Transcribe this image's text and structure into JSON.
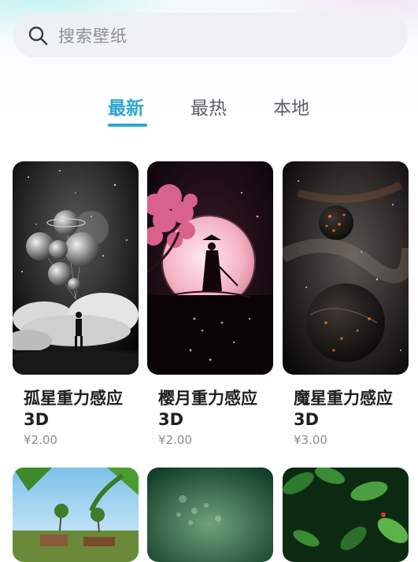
{
  "search": {
    "placeholder": "搜索壁纸",
    "icon": "search-icon"
  },
  "tabs": [
    {
      "label": "最新",
      "active": true
    },
    {
      "label": "最热",
      "active": false
    },
    {
      "label": "本地",
      "active": false
    }
  ],
  "accent_color": "#2fa6d1",
  "wallpapers": [
    {
      "title": "孤星重力感应3D",
      "price": "¥2.00"
    },
    {
      "title": "樱月重力感应3D",
      "price": "¥2.00"
    },
    {
      "title": "魔星重力感应3D",
      "price": "¥3.00"
    }
  ]
}
